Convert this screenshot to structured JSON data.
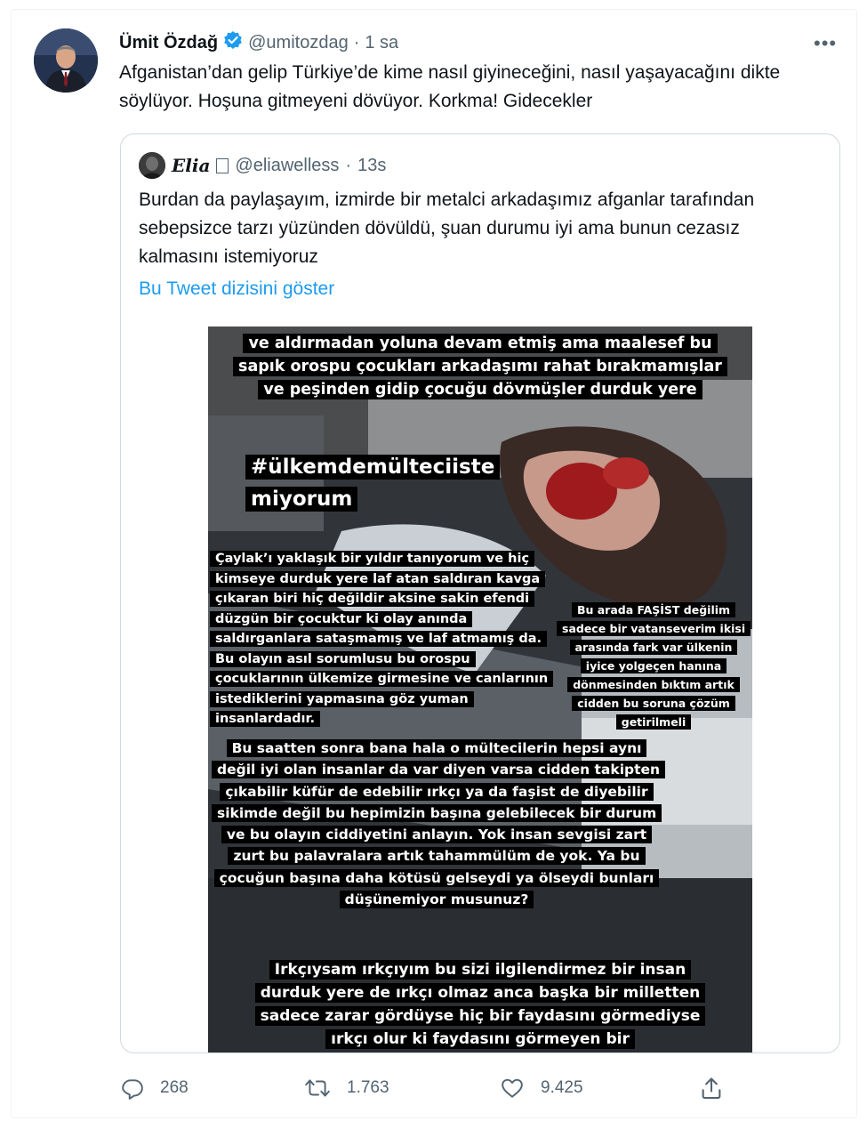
{
  "tweet": {
    "author_name": "Ümit Özdağ",
    "handle": "@umitozdag",
    "separator": "·",
    "time": "1 sa",
    "more_label": "•••",
    "text": "Afganistan’dan gelip Türkiye’de kime nasıl giyineceğini, nasıl yaşayacağını dikte söylüyor. Hoşuna gitmeyeni dövüyor. Korkma! Gidecekler"
  },
  "quote": {
    "author_name": "Elia",
    "handle": "@eliawelless",
    "separator": "·",
    "time": "13s",
    "text": "Burdan da paylaşayım, izmirde bir metalci arkadaşımız afganlar tarafından sebepsizce tarzı yüzünden dövüldü, şuan durumu iyi ama bunun cezasız kalmasını istemiyoruz",
    "show_thread": "Bu Tweet dizisini göster"
  },
  "media_overlays": {
    "top": "ve aldırmadan yoluna devam etmiş ama maalesef bu sapık orospu çocukları arkadaşımı rahat bırakmamışlar ve peşinden gidip çocuğu dövmüşler durduk yere",
    "hashtag_line1": "#ülkemdemülteciiste",
    "hashtag_line2": "miyorum",
    "left": "Çaylak’ı yaklaşık bir yıldır tanıyorum ve hiç kimseye durduk yere laf atan saldıran kavga çıkaran biri hiç değildir aksine sakin efendi düzgün bir çocuktur ki olay anında saldırganlara sataşmamış ve laf atmamış da. Bu olayın asıl sorumlusu bu orospu çocuklarının ülkemize girmesine ve canlarının istediklerini yapmasına göz yuman insanlardadır.",
    "right": "Bu arada FAŞİST değilim sadece bir vatanseverim ikisi arasında fark var ülkenin iyice yolgeçen hanına dönmesinden bıktım artık cidden bu soruna çözüm getirilmeli",
    "middle": "Bu saatten sonra bana hala o mültecilerin hepsi aynı değil iyi olan insanlar da var diyen varsa cidden takipten çıkabilir küfür de edebilir ırkçı ya da faşist de diyebilir sikimde değil bu hepimizin başına gelebilecek bir durum ve bu olayın ciddiyetini anlayın. Yok insan sevgisi zart zurt bu palavralara artık tahammülüm de yok. Ya bu çocuğun başına daha kötüsü gelseydi ya ölseydi bunları düşünemiyor musunuz?",
    "bottom": "Irkçıysam ırkçıyım bu sizi ilgilendirmez bir insan durduk yere de ırkçı olmaz anca başka bir milletten sadece zarar gördüyse hiç bir faydasını görmediyse ırkçı olur ki faydasını görmeyen bir"
  },
  "actions": {
    "reply_count": "268",
    "retweet_count": "1.763",
    "like_count": "9.425"
  },
  "icons": {
    "verified": "verified-badge-icon",
    "reply": "reply-icon",
    "retweet": "retweet-icon",
    "like": "heart-icon",
    "share": "share-icon"
  },
  "colors": {
    "verified": "#1d9bf0",
    "link": "#1d9bf0",
    "secondary_text": "#536471"
  }
}
